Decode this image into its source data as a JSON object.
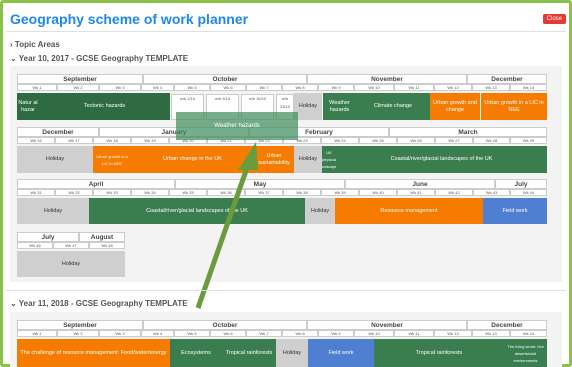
{
  "header": {
    "title": "Geography scheme of work planner",
    "close_label": "Close"
  },
  "sections": {
    "topic_areas": "Topic Areas",
    "year10": "Year 10, 2017 - GCSE Geography TEMPLATE",
    "year11": "Year 11, 2018 - GCSE Geography TEMPLATE"
  },
  "months": {
    "sep": "September",
    "oct": "October",
    "nov": "November",
    "dec": "December",
    "jan": "January",
    "feb": "February",
    "mar": "March",
    "apr": "April",
    "may": "May",
    "jun": "June",
    "jul": "July",
    "aug": "August"
  },
  "weeks": {
    "r1": [
      "Wk 1",
      "Wk 2",
      "Wk 3",
      "Wk 4",
      "Wk 5",
      "Wk 6",
      "Wk 7",
      "Wk 8",
      "Wk 9",
      "Wk 10",
      "Wk 11",
      "Wk 12",
      "Wk 13",
      "Wk 14",
      "Wk 15"
    ],
    "r2": [
      "Wk 16",
      "Wk 17",
      "Wk 18",
      "Wk 19",
      "Wk 20",
      "Wk 21",
      "Wk 22",
      "Wk 23",
      "Wk 24",
      "Wk 25",
      "Wk 26",
      "Wk 27",
      "Wk 28",
      "Wk 29",
      "Wk 30"
    ],
    "r3": [
      "Wk 31",
      "Wk 32",
      "Wk 33",
      "Wk 34",
      "Wk 35",
      "Wk 36",
      "Wk 37",
      "Wk 38",
      "Wk 39",
      "Wk 40",
      "Wk 41",
      "Wk 42",
      "Wk 43",
      "Wk 44",
      "Wk 45"
    ],
    "r4": [
      "Wk 46",
      "Wk 47",
      "Wk 48"
    ],
    "y11": [
      "Wk 1",
      "Wk 2",
      "Wk 3",
      "Wk 4",
      "Wk 5",
      "Wk 6",
      "Wk 7",
      "Wk 8",
      "Wk 9",
      "Wk 10",
      "Wk 11",
      "Wk 12",
      "Wk 13",
      "Wk 14",
      "Wk 15"
    ],
    "oct_small": [
      "w/b 2/10",
      "w/b 9/10",
      "w/b 16/10",
      "w/b 23/10"
    ]
  },
  "blocks": {
    "natural_hazards": "Natur al hazar",
    "tectonic": "Tectonic hazards",
    "weather_hazards": "Weather hazards",
    "holiday": "Holiday",
    "climate": "Climate change",
    "urban_growth_change": "Urban growth and change",
    "urban_lic": "Urban growth in a LIC in NEE",
    "urban_growth_lic_nee": "Urban growth in a LIC in NEE",
    "urban_change_uk": "Urban change in the UK",
    "urban_sustain": "Urban sustainability",
    "uk_physical": "UK physical landscapes",
    "coastal1": "Coastal/river/glacial landscapes of the UK",
    "coastal2": "Coastal/river/glacial landscapes of the UK",
    "resource": "Resource management",
    "fieldwork": "Field work",
    "y11_challenge": "The challenge of resource management: Food/water/energy",
    "ecosystems": "Ecosystems",
    "tropical": "Tropical rainforests",
    "y11_field": "Field work",
    "tropical2": "Tropical rainforests",
    "living_world": "The living world: Hot deserts/cold environments",
    "drag_label": "Weather hazards"
  },
  "colors": {
    "accent": "#1e88e5",
    "green": "#3a7d4f",
    "orange": "#f57c00",
    "blue": "#4f7fd1",
    "holiday": "#cfcfcf",
    "frame": "#8bc34a"
  }
}
